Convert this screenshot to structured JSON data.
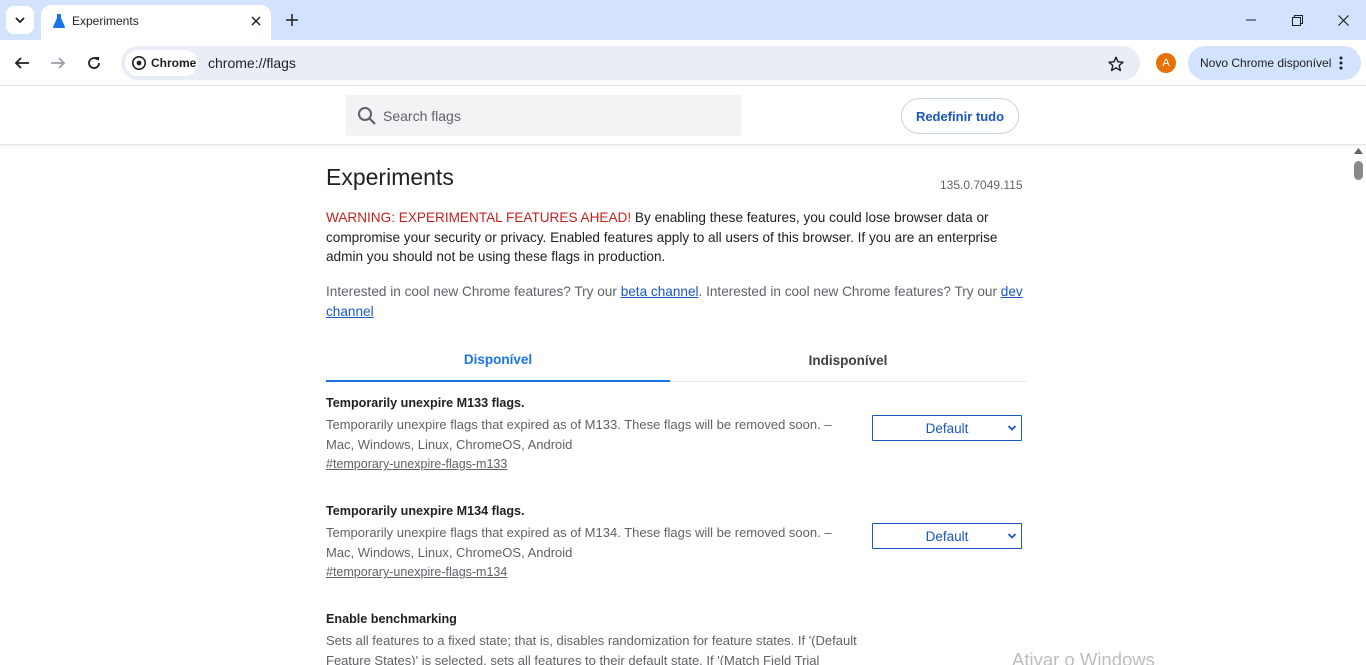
{
  "browser": {
    "tab": {
      "title": "Experiments",
      "favicon": "flask-icon"
    },
    "omnibox": {
      "chip_label": "Chrome",
      "url": "chrome://flags"
    },
    "profile_initial": "A",
    "update_label": "Novo Chrome disponível"
  },
  "flags_header": {
    "search_placeholder": "Search flags",
    "reset_label": "Redefinir tudo"
  },
  "page": {
    "title": "Experiments",
    "version": "135.0.7049.115",
    "warning_lead": "WARNING: EXPERIMENTAL FEATURES AHEAD!",
    "warning_body": " By enabling these features, you could lose browser data or compromise your security or privacy. Enabled features apply to all users of this browser. If you are an enterprise admin you should not be using these flags in production.",
    "interest_text_1": "Interested in cool new Chrome features? Try our ",
    "beta_link": "beta channel",
    "interest_text_2": ". Interested in cool new Chrome features? Try our ",
    "dev_link": "dev channel"
  },
  "tabs": [
    {
      "label": "Disponível",
      "active": true
    },
    {
      "label": "Indisponível",
      "active": false
    }
  ],
  "flags": [
    {
      "name": "Temporarily unexpire M133 flags.",
      "description": "Temporarily unexpire flags that expired as of M133. These flags will be removed soon. – Mac, Windows, Linux, ChromeOS, Android",
      "link": "#temporary-unexpire-flags-m133",
      "value": "Default"
    },
    {
      "name": "Temporarily unexpire M134 flags.",
      "description": "Temporarily unexpire flags that expired as of M134. These flags will be removed soon. – Mac, Windows, Linux, ChromeOS, Android",
      "link": "#temporary-unexpire-flags-m134",
      "value": "Default"
    },
    {
      "name": "Enable benchmarking",
      "description": "Sets all features to a fixed state; that is, disables randomization for feature states. If '(Default Feature States)' is selected, sets all features to their default state. If '(Match Field Trial Testing"
    }
  ],
  "watermark": "Ativar o Windows",
  "colors": {
    "tabstrip": "#d3e3fd",
    "accent": "#1a73e8",
    "link": "#1a57c3",
    "warning": "#c5221f",
    "avatar": "#e8710a"
  }
}
